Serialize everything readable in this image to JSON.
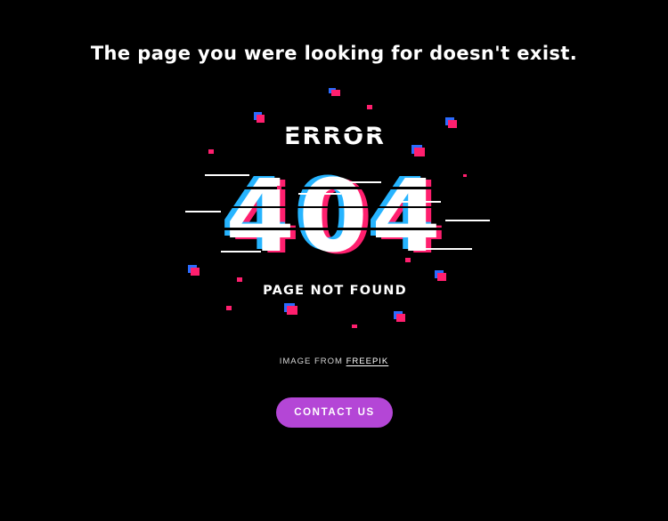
{
  "page": {
    "heading": "The page you were looking for doesn't exist.",
    "background_color": "#000000"
  },
  "illustration": {
    "top_label": "ERROR",
    "code": "404",
    "bottom_label": "PAGE NOT FOUND",
    "glitch_colors": {
      "pink": "#ff1f6e",
      "blue": "#2b6bff",
      "cyan": "#26e0ff",
      "white": "#ffffff"
    }
  },
  "credit": {
    "prefix": "IMAGE FROM",
    "link_text": "FREEPIK"
  },
  "contact_button": {
    "label": "CONTACT US",
    "color": "#b446d6"
  }
}
